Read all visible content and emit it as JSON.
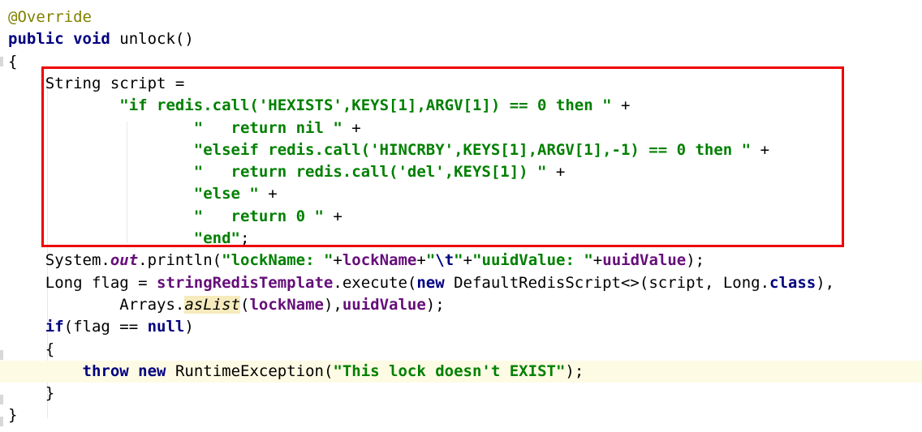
{
  "editor": {
    "lines": [
      {
        "tokens": [
          {
            "t": "@Override",
            "c": "ann"
          }
        ]
      },
      {
        "tokens": [
          {
            "t": "public",
            "c": "kw"
          },
          {
            "t": " ",
            "c": "pl"
          },
          {
            "t": "void",
            "c": "kw"
          },
          {
            "t": " unlock()",
            "c": "pl"
          }
        ]
      },
      {
        "tokens": [
          {
            "t": "{",
            "c": "pl"
          }
        ]
      },
      {
        "tokens": [
          {
            "t": "    String script =",
            "c": "pl"
          }
        ]
      },
      {
        "tokens": [
          {
            "t": "            ",
            "c": "pl"
          },
          {
            "t": "\"if redis.call('HEXISTS',KEYS[1],ARGV[1]) == 0 then \"",
            "c": "str"
          },
          {
            "t": " +",
            "c": "pl"
          }
        ]
      },
      {
        "tokens": [
          {
            "t": "                    ",
            "c": "pl"
          },
          {
            "t": "\"   return nil \"",
            "c": "str"
          },
          {
            "t": " +",
            "c": "pl"
          }
        ]
      },
      {
        "tokens": [
          {
            "t": "                    ",
            "c": "pl"
          },
          {
            "t": "\"elseif redis.call('HINCRBY',KEYS[1],ARGV[1],-1) == 0 then \"",
            "c": "str"
          },
          {
            "t": " +",
            "c": "pl"
          }
        ]
      },
      {
        "tokens": [
          {
            "t": "                    ",
            "c": "pl"
          },
          {
            "t": "\"   return redis.call('del',KEYS[1]) \"",
            "c": "str"
          },
          {
            "t": " +",
            "c": "pl"
          }
        ]
      },
      {
        "tokens": [
          {
            "t": "                    ",
            "c": "pl"
          },
          {
            "t": "\"else \"",
            "c": "str"
          },
          {
            "t": " +",
            "c": "pl"
          }
        ]
      },
      {
        "tokens": [
          {
            "t": "                    ",
            "c": "pl"
          },
          {
            "t": "\"   return 0 \"",
            "c": "str"
          },
          {
            "t": " +",
            "c": "pl"
          }
        ]
      },
      {
        "tokens": [
          {
            "t": "                    ",
            "c": "pl"
          },
          {
            "t": "\"end\"",
            "c": "str"
          },
          {
            "t": ";",
            "c": "pl"
          }
        ]
      },
      {
        "tokens": [
          {
            "t": "    System.",
            "c": "pl"
          },
          {
            "t": "out",
            "c": "static"
          },
          {
            "t": ".println(",
            "c": "pl"
          },
          {
            "t": "\"lockName: \"",
            "c": "str"
          },
          {
            "t": "+",
            "c": "pl"
          },
          {
            "t": "lockName",
            "c": "field"
          },
          {
            "t": "+",
            "c": "pl"
          },
          {
            "t": "\"",
            "c": "str"
          },
          {
            "t": "\\t",
            "c": "esc"
          },
          {
            "t": "\"",
            "c": "str"
          },
          {
            "t": "+",
            "c": "pl"
          },
          {
            "t": "\"uuidValue: \"",
            "c": "str"
          },
          {
            "t": "+",
            "c": "pl"
          },
          {
            "t": "uuidValue",
            "c": "field"
          },
          {
            "t": ");",
            "c": "pl"
          }
        ]
      },
      {
        "tokens": [
          {
            "t": "    Long flag = ",
            "c": "pl"
          },
          {
            "t": "stringRedisTemplate",
            "c": "field"
          },
          {
            "t": ".execute(",
            "c": "pl"
          },
          {
            "t": "new",
            "c": "kw"
          },
          {
            "t": " DefaultRedisScript<>(script, Long.",
            "c": "pl"
          },
          {
            "t": "class",
            "c": "kw"
          },
          {
            "t": "),",
            "c": "pl"
          }
        ]
      },
      {
        "tokens": [
          {
            "t": "            Arrays.",
            "c": "pl"
          },
          {
            "t": "asList",
            "c": "staticm hl-usage"
          },
          {
            "t": "(",
            "c": "pl"
          },
          {
            "t": "lockName",
            "c": "field"
          },
          {
            "t": "),",
            "c": "pl"
          },
          {
            "t": "uuidValue",
            "c": "field"
          },
          {
            "t": ");",
            "c": "pl"
          }
        ]
      },
      {
        "tokens": [
          {
            "t": "    ",
            "c": "pl"
          },
          {
            "t": "if",
            "c": "kw"
          },
          {
            "t": "(flag == ",
            "c": "pl"
          },
          {
            "t": "null",
            "c": "kw"
          },
          {
            "t": ")",
            "c": "pl"
          }
        ]
      },
      {
        "tokens": [
          {
            "t": "    {",
            "c": "pl"
          }
        ]
      },
      {
        "tokens": [
          {
            "t": "        ",
            "c": "pl"
          },
          {
            "t": "throw",
            "c": "kw"
          },
          {
            "t": " ",
            "c": "pl"
          },
          {
            "t": "new",
            "c": "kw"
          },
          {
            "t": " RuntimeException(",
            "c": "pl"
          },
          {
            "t": "\"This lock doesn't EXIST\"",
            "c": "str"
          },
          {
            "t": ");",
            "c": "pl"
          }
        ]
      },
      {
        "tokens": [
          {
            "t": "    }",
            "c": "pl"
          }
        ]
      },
      {
        "tokens": [
          {
            "t": "}",
            "c": "pl"
          }
        ]
      }
    ]
  }
}
